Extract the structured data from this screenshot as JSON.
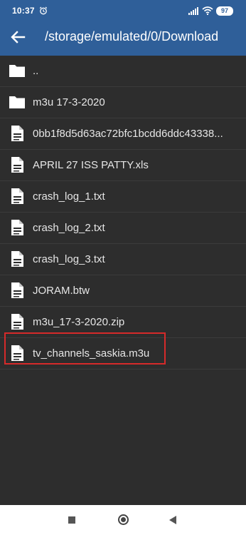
{
  "status_bar": {
    "time": "10:37",
    "battery": "97",
    "icons": [
      "alarm-icon",
      "signal-icon",
      "wifi-icon",
      "battery-icon"
    ]
  },
  "toolbar": {
    "path": "/storage/emulated/0/Download",
    "back_icon": "arrow-left-icon"
  },
  "files": [
    {
      "name": "..",
      "type": "folder"
    },
    {
      "name": "m3u 17-3-2020",
      "type": "folder"
    },
    {
      "name": "0bb1f8d5d63ac72bfc1bcdd6ddc43338...",
      "type": "file"
    },
    {
      "name": "APRIL 27 ISS PATTY.xls",
      "type": "file"
    },
    {
      "name": "crash_log_1.txt",
      "type": "file"
    },
    {
      "name": "crash_log_2.txt",
      "type": "file"
    },
    {
      "name": "crash_log_3.txt",
      "type": "file"
    },
    {
      "name": "JORAM.btw",
      "type": "file"
    },
    {
      "name": "m3u_17-3-2020.zip",
      "type": "file"
    },
    {
      "name": "tv_channels_saskia.m3u",
      "type": "file",
      "highlighted": true
    }
  ],
  "colors": {
    "toolbar": "#2f5f99",
    "background": "#2d2d2d",
    "highlight": "#d62a2a"
  },
  "navigation": {
    "icons": [
      "recent-apps-icon",
      "home-icon",
      "back-icon"
    ]
  }
}
